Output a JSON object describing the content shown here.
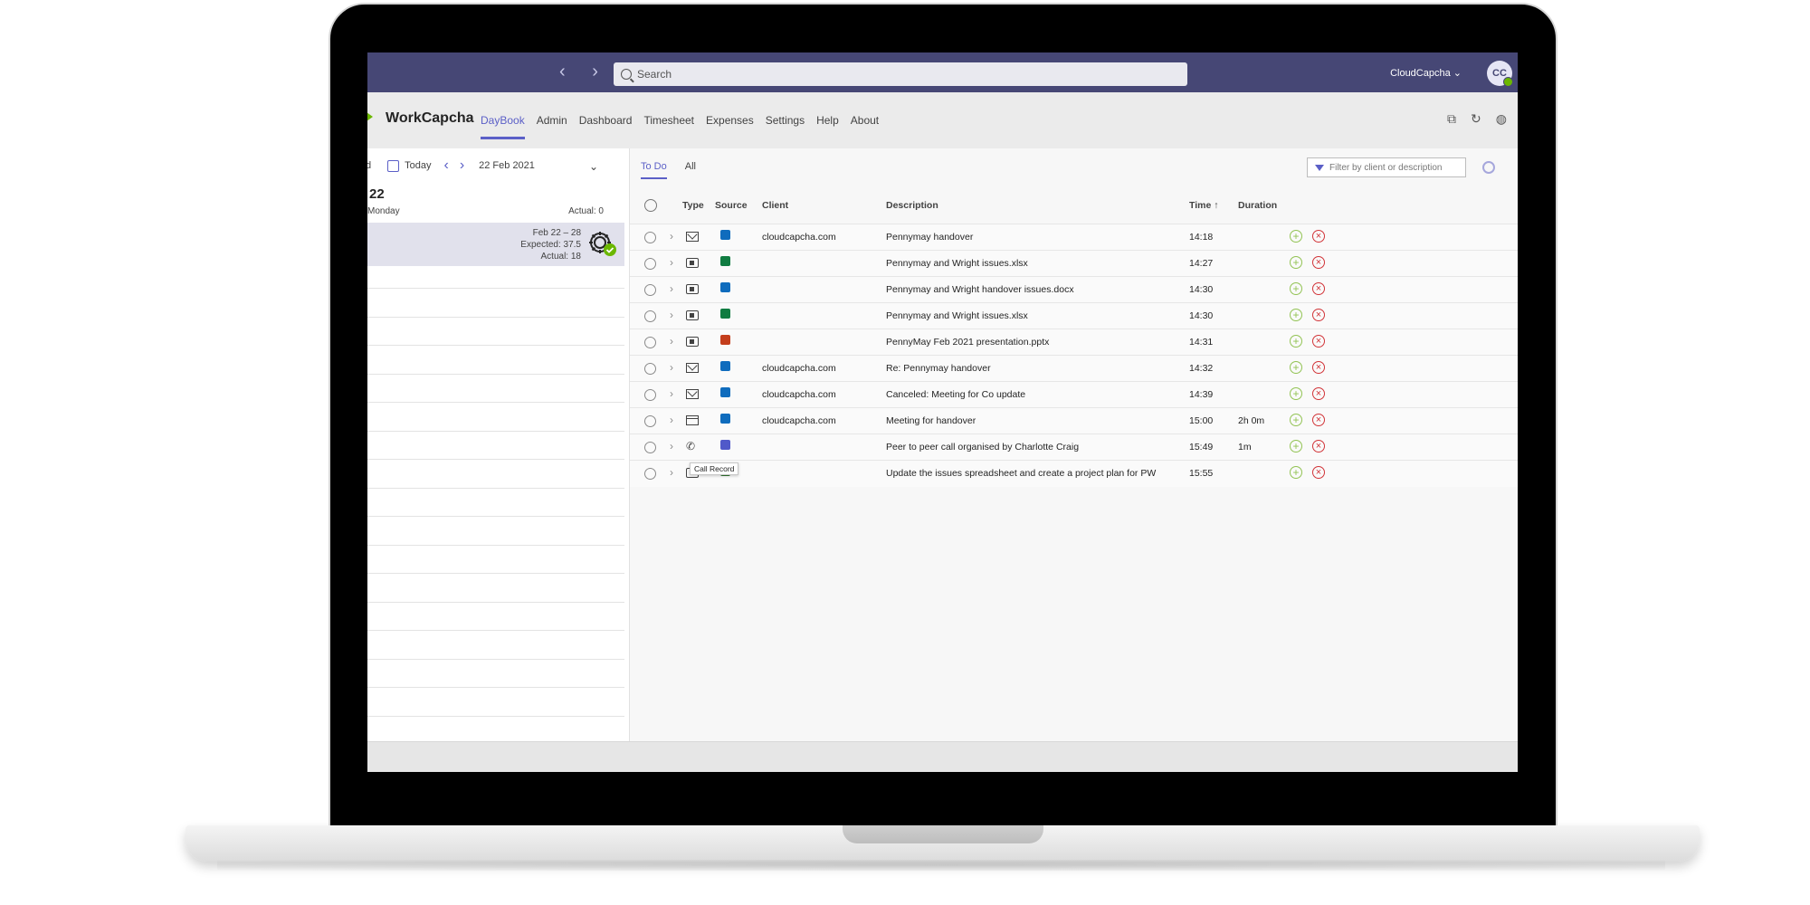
{
  "topbar": {
    "search_placeholder": "Search",
    "account_name": "CloudCapcha ⌄",
    "avatar_initials": "CC"
  },
  "app": {
    "name": "WorkCapcha",
    "tabs": [
      "DayBook",
      "Admin",
      "Dashboard",
      "Timesheet",
      "Expenses",
      "Settings",
      "Help",
      "About"
    ],
    "active_tab": "DayBook"
  },
  "left_panel": {
    "cut_label": "d",
    "today_label": "Today",
    "date_value": "22 Feb 2021",
    "day_number": "22",
    "day_name": "Monday",
    "day_actual": "Actual: 0",
    "week_range": "Feb 22 – 28",
    "week_expected": "Expected: 37.5",
    "week_actual": "Actual: 18"
  },
  "main": {
    "filter_tabs": [
      "To Do",
      "All"
    ],
    "active_filter_tab": "To Do",
    "filter_placeholder": "Filter by client or description",
    "columns": {
      "type": "Type",
      "source": "Source",
      "client": "Client",
      "description": "Description",
      "time": "Time ↑",
      "duration": "Duration"
    },
    "tooltip": "Call Record",
    "rows": [
      {
        "type": "mail-icon",
        "source": "outlook-icon",
        "client": "cloudcapcha.com",
        "description": "Pennymay handover",
        "time": "14:18",
        "duration": ""
      },
      {
        "type": "office-file-icon",
        "source": "excel-icon",
        "client": "",
        "description": "Pennymay and Wright issues.xlsx",
        "time": "14:27",
        "duration": ""
      },
      {
        "type": "office-file-icon",
        "source": "outlook-icon",
        "client": "",
        "description": "Pennymay and Wright handover issues.docx",
        "time": "14:30",
        "duration": ""
      },
      {
        "type": "office-file-icon",
        "source": "excel-icon",
        "client": "",
        "description": "Pennymay and Wright issues.xlsx",
        "time": "14:30",
        "duration": ""
      },
      {
        "type": "office-file-icon",
        "source": "powerpoint-icon",
        "client": "",
        "description": "PennyMay Feb 2021 presentation.pptx",
        "time": "14:31",
        "duration": ""
      },
      {
        "type": "mail-icon",
        "source": "outlook-icon",
        "client": "cloudcapcha.com",
        "description": "Re: Pennymay handover",
        "time": "14:32",
        "duration": ""
      },
      {
        "type": "mail-icon",
        "source": "outlook-icon",
        "client": "cloudcapcha.com",
        "description": "Canceled: Meeting for Co update",
        "time": "14:39",
        "duration": ""
      },
      {
        "type": "calendar-icon",
        "source": "outlook-icon",
        "client": "cloudcapcha.com",
        "description": "Meeting for handover",
        "time": "15:00",
        "duration": "2h 0m"
      },
      {
        "type": "phone-icon",
        "source": "teams-icon",
        "client": "",
        "description": "Peer to peer call organised by Charlotte Craig",
        "time": "15:49",
        "duration": "1m"
      },
      {
        "type": "office-file-icon",
        "source": "planner-icon",
        "client": "",
        "description": "Update the issues spreadsheet and create a project plan for PW",
        "time": "15:55",
        "duration": ""
      }
    ]
  },
  "colors": {
    "teams_header": "#464775",
    "accent": "#5b5fc7",
    "add_green": "#92c353",
    "delete_red": "#d13438",
    "outlook_blue": "#0f6cbd",
    "excel_green": "#107c41",
    "powerpoint_red": "#c43e1c",
    "teams_purple": "#5059c9"
  }
}
